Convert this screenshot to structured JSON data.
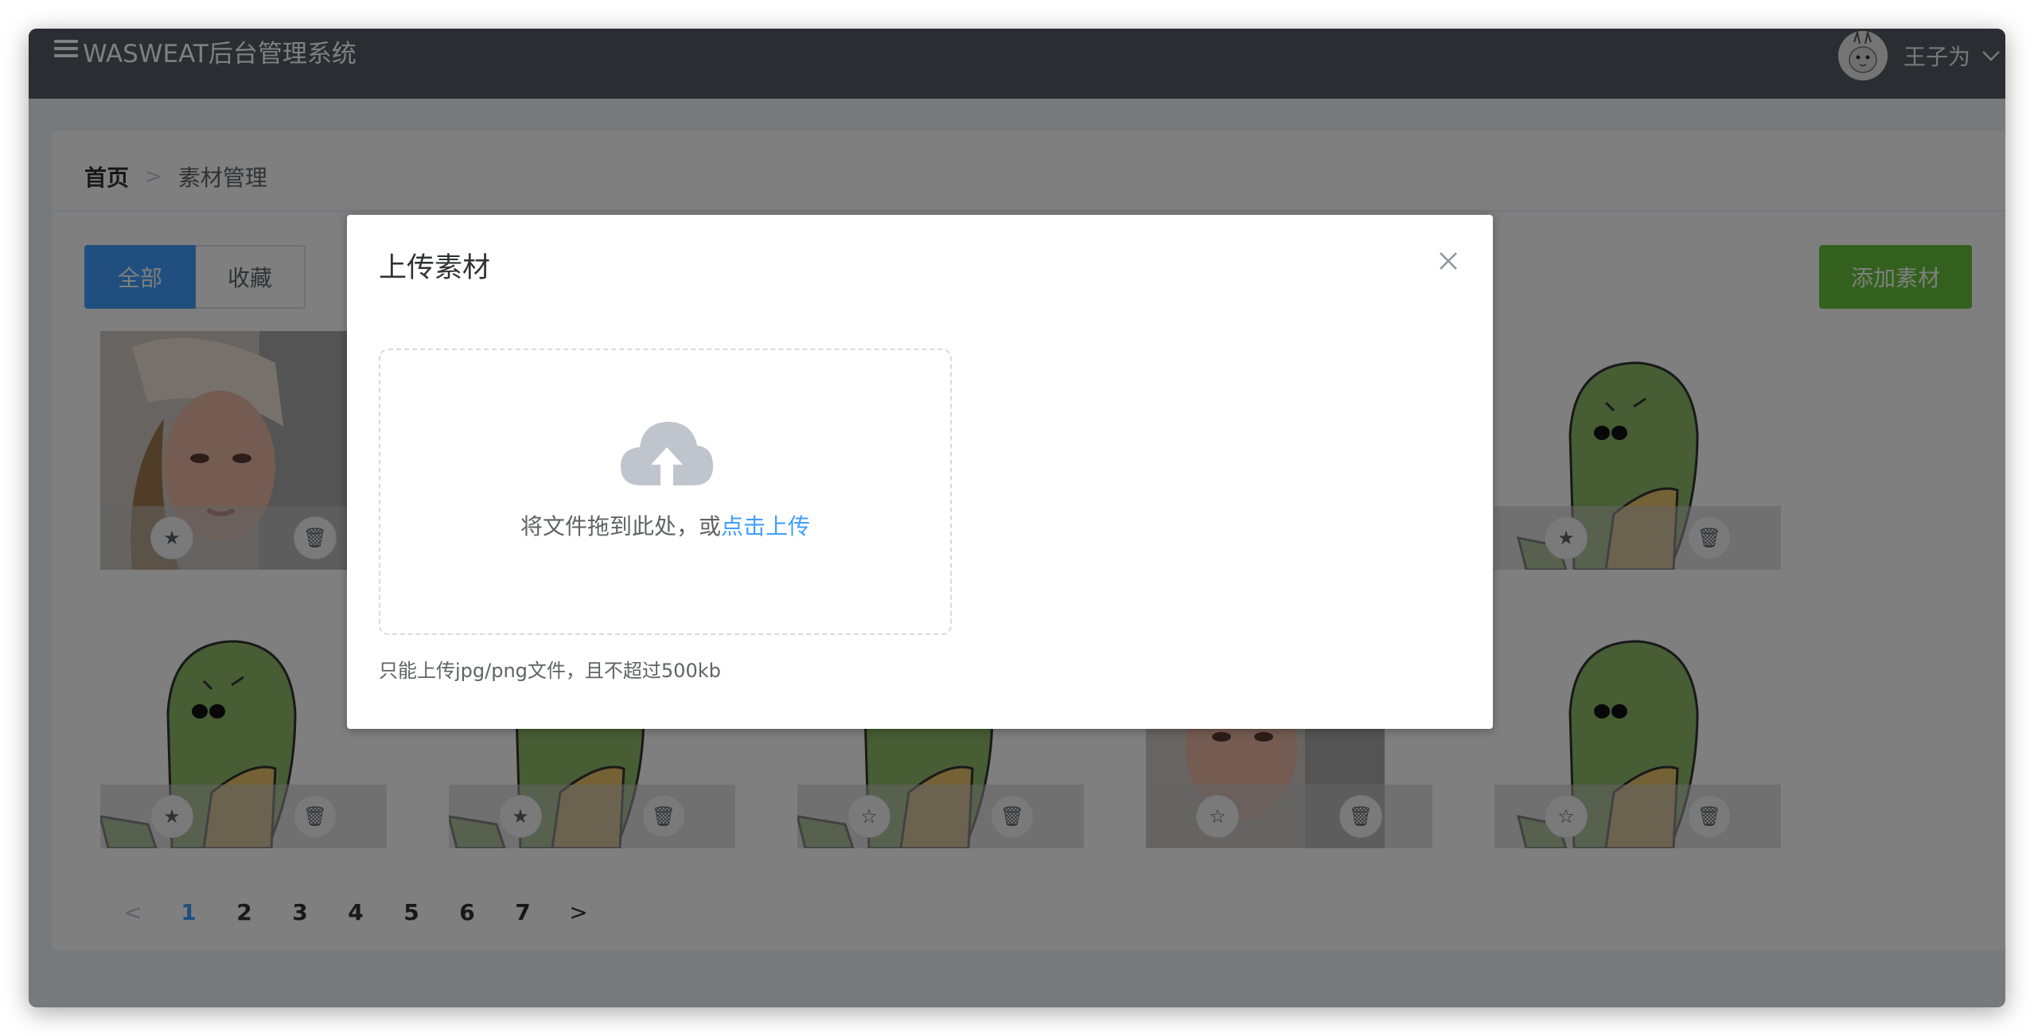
{
  "header": {
    "title": "WASWEAT后台管理系统",
    "username": "王子为"
  },
  "breadcrumb": {
    "home": "首页",
    "separator": ">",
    "current": "素材管理"
  },
  "tabs": [
    {
      "label": "全部",
      "active": true
    },
    {
      "label": "收藏",
      "active": false
    }
  ],
  "add_button": "添加素材",
  "cards": [
    {
      "image": "photo-girl",
      "starred": true
    },
    {
      "image": "dinosaur",
      "starred": true
    },
    {
      "image": "dinosaur",
      "starred": true
    },
    {
      "image": "dinosaur",
      "starred": true
    },
    {
      "image": "dinosaur",
      "starred": false
    },
    {
      "image": "photo-girl",
      "starred": false
    },
    {
      "image": "dinosaur",
      "starred": false
    }
  ],
  "pagination": {
    "pages": [
      "1",
      "2",
      "3",
      "4",
      "5",
      "6",
      "7"
    ],
    "current": "1",
    "prev": "<",
    "next": ">"
  },
  "dialog": {
    "title": "上传素材",
    "close_icon": "close-icon",
    "drop_text": "将文件拖到此处，或",
    "drop_link": "点击上传",
    "tip": "只能上传jpg/png文件，且不超过500kb"
  },
  "colors": {
    "header_bg": "#545c64",
    "primary": "#409eff",
    "success": "#67c23a"
  }
}
